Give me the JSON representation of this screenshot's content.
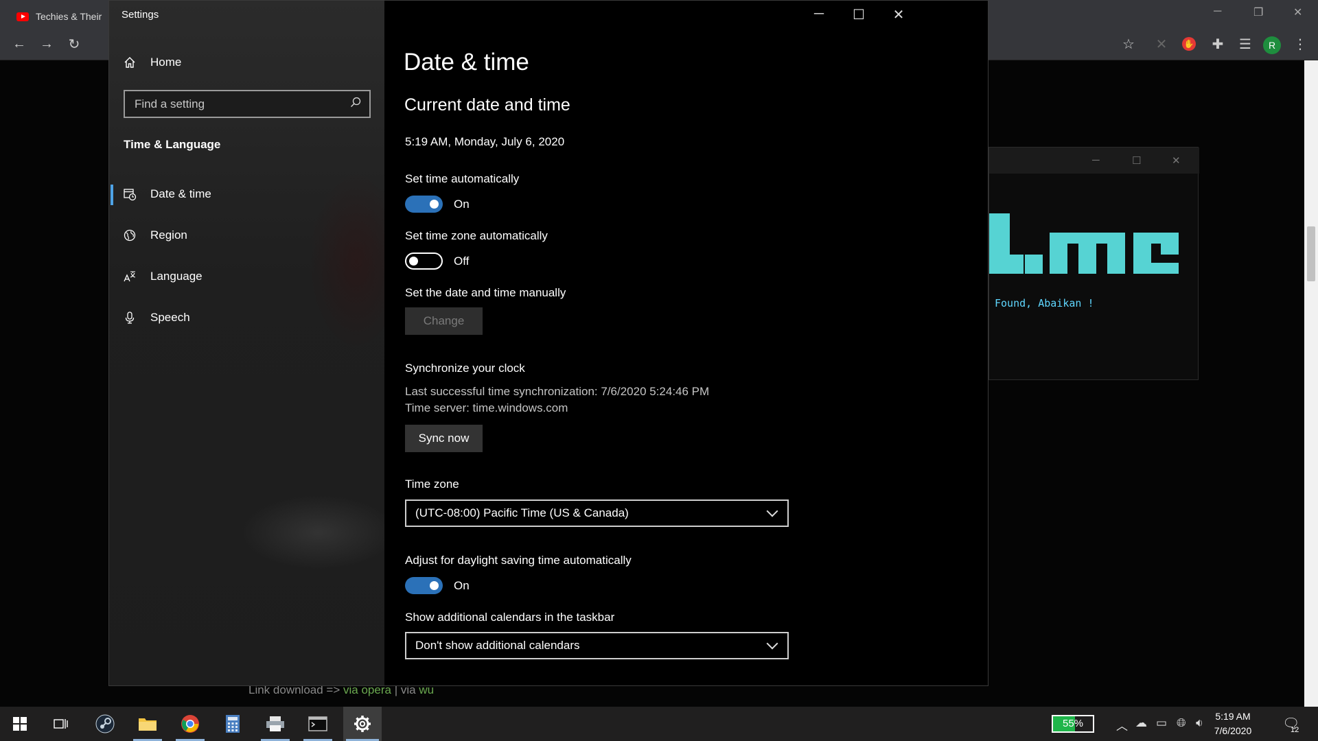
{
  "browser": {
    "tab_title": "Techies & Their",
    "minimize": "─",
    "restore": "❐",
    "close": "✕",
    "profile_initial": "R"
  },
  "background_page": {
    "terminal_text": "Found, Abaikan !",
    "link_prefix": "Link download =>",
    "link_opera": "via opera",
    "link_sep": "|",
    "link_via": "via",
    "link_wu": "wu"
  },
  "settings": {
    "app_title": "Settings",
    "home_label": "Home",
    "search_placeholder": "Find a setting",
    "section_label": "Time & Language",
    "nav": [
      {
        "label": "Date & time",
        "icon": "calendar-clock-icon",
        "active": true
      },
      {
        "label": "Region",
        "icon": "globe-icon",
        "active": false
      },
      {
        "label": "Language",
        "icon": "language-icon",
        "active": false
      },
      {
        "label": "Speech",
        "icon": "microphone-icon",
        "active": false
      }
    ],
    "page_title": "Date & time",
    "subtitle": "Current date and time",
    "current_datetime": "5:19 AM, Monday, July 6, 2020",
    "set_time_auto": {
      "label": "Set time automatically",
      "state": "On",
      "on": true
    },
    "set_tz_auto": {
      "label": "Set time zone automatically",
      "state": "Off",
      "on": false
    },
    "manual": {
      "label": "Set the date and time manually",
      "button": "Change"
    },
    "sync": {
      "title": "Synchronize your clock",
      "last_sync": "Last successful time synchronization: 7/6/2020 5:24:46 PM",
      "server": "Time server: time.windows.com",
      "button": "Sync now"
    },
    "timezone": {
      "label": "Time zone",
      "value": "(UTC-08:00) Pacific Time (US & Canada)"
    },
    "dst": {
      "label": "Adjust for daylight saving time automatically",
      "state": "On",
      "on": true
    },
    "calendars": {
      "label": "Show additional calendars in the taskbar",
      "value": "Don't show additional calendars"
    }
  },
  "taskbar": {
    "battery_percent": "55%",
    "battery_level": 0.55,
    "time": "5:19 AM",
    "date": "7/6/2020",
    "notification_count": "12",
    "accent": "#1fb54a"
  }
}
